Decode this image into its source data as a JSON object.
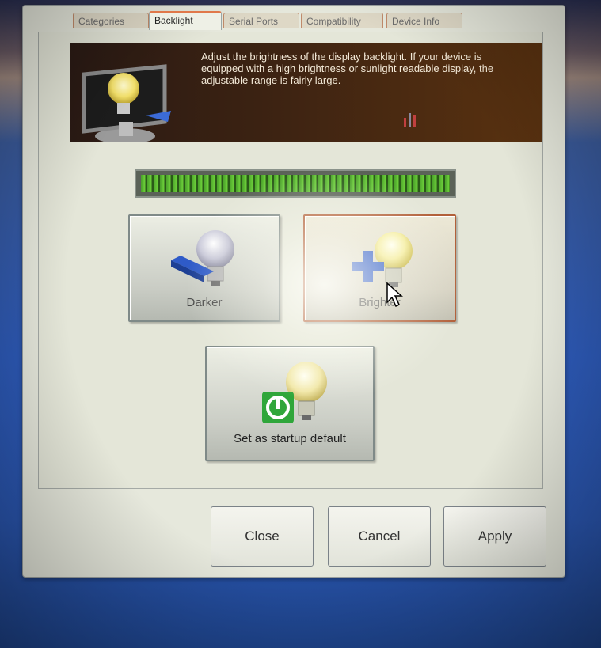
{
  "tabs": [
    {
      "label": "Categories",
      "active": false
    },
    {
      "label": "Backlight",
      "active": true
    },
    {
      "label": "Serial Ports",
      "active": false
    },
    {
      "label": "Compatibility",
      "active": false
    },
    {
      "label": "Device Info",
      "active": false
    }
  ],
  "banner": {
    "description": "Adjust the brightness of the display backlight. If your device is equipped with a high brightness or sunlight readable display, the adjustable range is fairly large.",
    "icon": "monitor-lightbulb-icon"
  },
  "brightness": {
    "level_fraction": 1.0
  },
  "buttons": {
    "darker": {
      "label": "Darker",
      "icon": "lightbulb-minus-icon"
    },
    "brighter": {
      "label": "Brighter",
      "icon": "lightbulb-plus-icon"
    },
    "startup_default": {
      "label": "Set as startup default",
      "icon": "lightbulb-power-icon"
    }
  },
  "dialog_buttons": {
    "close": "Close",
    "cancel": "Cancel",
    "apply": "Apply"
  },
  "colors": {
    "active_tab_accent": "#e0784a",
    "level_bar_green": "#6ccf3a",
    "desktop_blue": "#2d5ab8"
  }
}
